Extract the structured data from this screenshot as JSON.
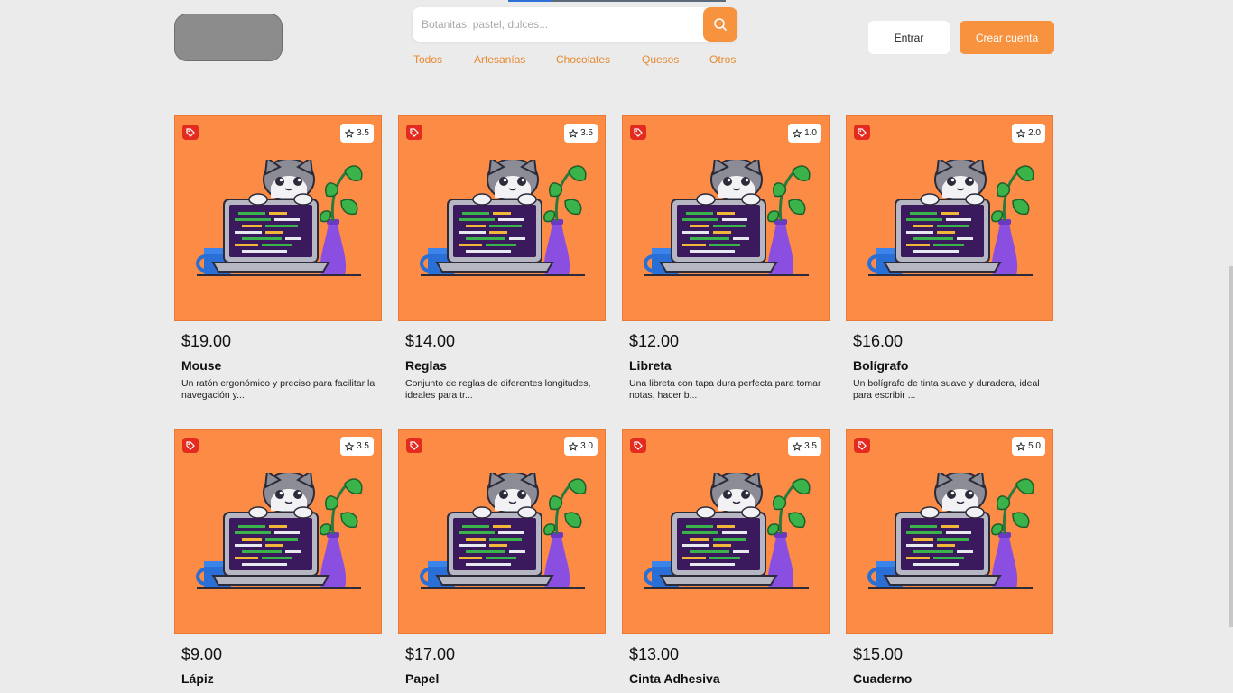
{
  "header": {
    "search_placeholder": "Botanitas, pastel, dulces...",
    "categories": [
      "Todos",
      "Artesanías",
      "Chocolates",
      "Quesos",
      "Otros"
    ],
    "login_label": "Entrar",
    "signup_label": "Crear cuenta"
  },
  "icons": {
    "search": "search-icon",
    "tag": "tag-icon",
    "star": "star-icon"
  },
  "colors": {
    "accent": "#f7923f",
    "card_bg": "#fb8b45",
    "tag_red": "#e42b1f",
    "category_text": "#e8892f",
    "page_bg": "#ebebeb"
  },
  "products": [
    {
      "price": "$19.00",
      "name": "Mouse",
      "rating": "3.5",
      "description": "Un ratón ergonómico y preciso para facilitar la navegación y..."
    },
    {
      "price": "$14.00",
      "name": "Reglas",
      "rating": "3.5",
      "description": "Conjunto de reglas de diferentes longitudes, ideales para tr..."
    },
    {
      "price": "$12.00",
      "name": "Libreta",
      "rating": "1.0",
      "description": "Una libreta con tapa dura perfecta para tomar notas, hacer b..."
    },
    {
      "price": "$16.00",
      "name": "Bolígrafo",
      "rating": "2.0",
      "description": "Un bolígrafo de tinta suave y duradera, ideal para escribir ..."
    },
    {
      "price": "$9.00",
      "name": "Lápiz",
      "rating": "3.5",
      "description": ""
    },
    {
      "price": "$17.00",
      "name": "Papel",
      "rating": "3.0",
      "description": ""
    },
    {
      "price": "$13.00",
      "name": "Cinta Adhesiva",
      "rating": "3.5",
      "description": ""
    },
    {
      "price": "$15.00",
      "name": "Cuaderno",
      "rating": "5.0",
      "description": ""
    }
  ]
}
